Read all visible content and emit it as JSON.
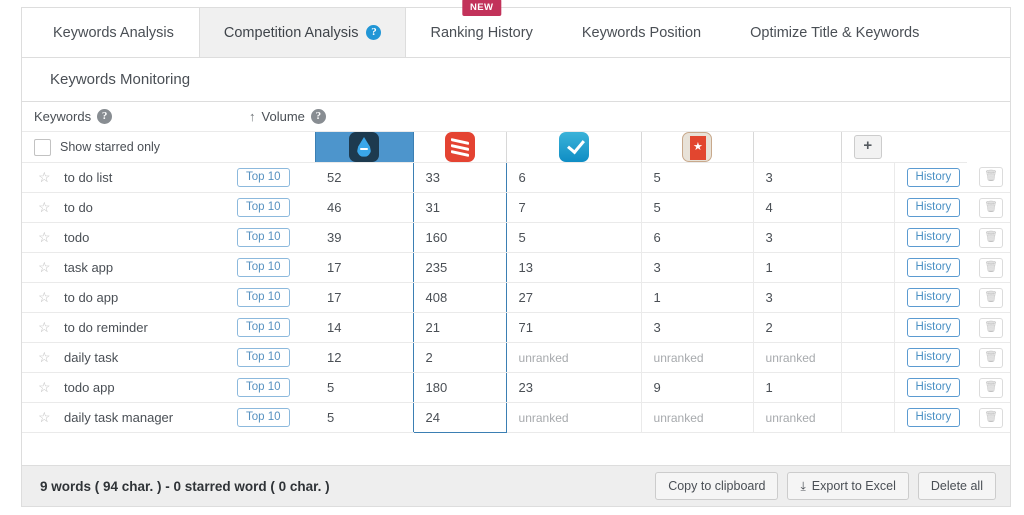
{
  "tabs": [
    {
      "label": "Keywords Analysis",
      "active": false,
      "help": false,
      "new": false
    },
    {
      "label": "Competition Analysis",
      "active": true,
      "help": true,
      "new": false
    },
    {
      "label": "Ranking History",
      "active": false,
      "help": false,
      "new": true,
      "badge": "NEW"
    },
    {
      "label": "Keywords Position",
      "active": false,
      "help": false,
      "new": false
    },
    {
      "label": "Optimize Title & Keywords",
      "active": false,
      "help": false,
      "new": false
    }
  ],
  "section": {
    "title": "Keywords Monitoring"
  },
  "table": {
    "header": {
      "keywords_label": "Keywords",
      "volume_label": "Volume",
      "sort_arrow": "↑",
      "show_starred_label": "Show starred only",
      "add_button": "+",
      "help_glyph": "?"
    },
    "apps": [
      {
        "name": "any-do",
        "icon": "anydo-app-icon",
        "selected": true
      },
      {
        "name": "todoist",
        "icon": "todoist-app-icon",
        "selected": false
      },
      {
        "name": "ticktick",
        "icon": "ticktick-app-icon",
        "selected": false
      },
      {
        "name": "wunderlist",
        "icon": "wunderlist-app-icon",
        "selected": false
      }
    ],
    "row_labels": {
      "top_badge": "Top 10",
      "history": "History",
      "delete_glyph": "Ὕ1",
      "star_glyph": "☆",
      "unranked": "unranked"
    },
    "rows": [
      {
        "keyword": "to do list",
        "top": "Top 10",
        "volume": "52",
        "ranks": [
          "33",
          "6",
          "5",
          "3"
        ]
      },
      {
        "keyword": "to do",
        "top": "Top 10",
        "volume": "46",
        "ranks": [
          "31",
          "7",
          "5",
          "4"
        ]
      },
      {
        "keyword": "todo",
        "top": "Top 10",
        "volume": "39",
        "ranks": [
          "160",
          "5",
          "6",
          "3"
        ]
      },
      {
        "keyword": "task app",
        "top": "Top 10",
        "volume": "17",
        "ranks": [
          "235",
          "13",
          "3",
          "1"
        ]
      },
      {
        "keyword": "to do app",
        "top": "Top 10",
        "volume": "17",
        "ranks": [
          "408",
          "27",
          "1",
          "3"
        ]
      },
      {
        "keyword": "to do reminder",
        "top": "Top 10",
        "volume": "14",
        "ranks": [
          "21",
          "71",
          "3",
          "2"
        ]
      },
      {
        "keyword": "daily task",
        "top": "Top 10",
        "volume": "12",
        "ranks": [
          "2",
          "unranked",
          "unranked",
          "unranked"
        ]
      },
      {
        "keyword": "todo app",
        "top": "Top 10",
        "volume": "5",
        "ranks": [
          "180",
          "23",
          "9",
          "1"
        ]
      },
      {
        "keyword": "daily task manager",
        "top": "Top 10",
        "volume": "5",
        "ranks": [
          "24",
          "unranked",
          "unranked",
          "unranked"
        ]
      }
    ]
  },
  "footer": {
    "summary": "9 words ( 94 char. ) - 0 starred word ( 0 char. )",
    "copy_label": "Copy to clipboard",
    "export_label": "Export to Excel",
    "export_icon": "⤓",
    "delete_all_label": "Delete all"
  },
  "colors": {
    "accent_blue": "#4d95cc",
    "badge_new": "#c2325a",
    "help_blue": "#2196d6"
  }
}
